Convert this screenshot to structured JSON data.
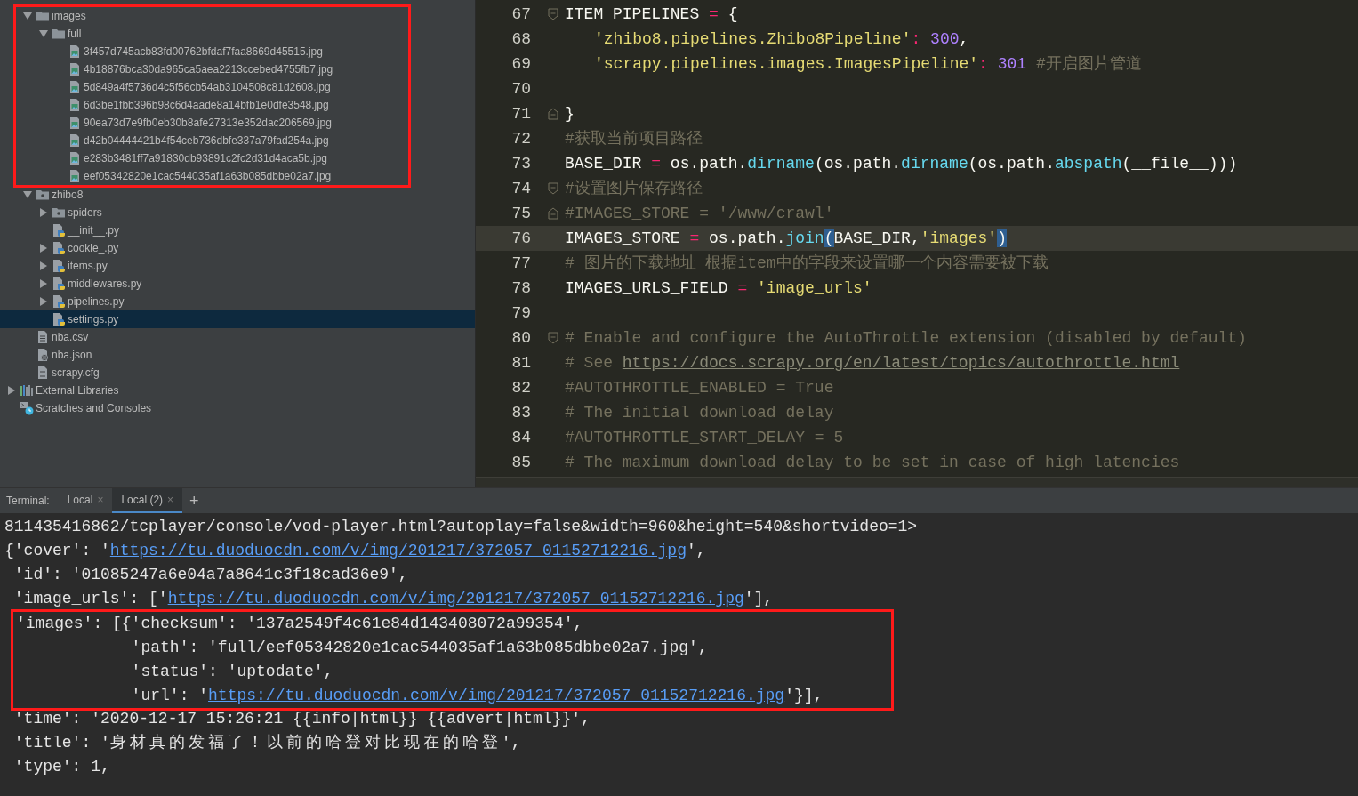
{
  "project_tree": {
    "project_items": [
      {
        "label": "images",
        "kind": "folder",
        "expanded": true,
        "highlighted": true,
        "selected": false,
        "children": [
          {
            "label": "full",
            "kind": "folder",
            "expanded": true,
            "selected": false,
            "children": [
              {
                "label": "3f457d745acb83fd00762bfdaf7faa8669d45515.jpg",
                "kind": "image",
                "selected": false
              },
              {
                "label": "4b18876bca30da965ca5aea2213ccebed4755fb7.jpg",
                "kind": "image",
                "selected": false
              },
              {
                "label": "5d849a4f5736d4c5f56cb54ab3104508c81d2608.jpg",
                "kind": "image",
                "selected": false
              },
              {
                "label": "6d3be1fbb396b98c6d4aade8a14bfb1e0dfe3548.jpg",
                "kind": "image",
                "selected": false
              },
              {
                "label": "90ea73d7e9fb0eb30b8afe27313e352dac206569.jpg",
                "kind": "image",
                "selected": false
              },
              {
                "label": "d42b04444421b4f54ceb736dbfe337a79fad254a.jpg",
                "kind": "image",
                "selected": false
              },
              {
                "label": "e283b3481ff7a91830db93891c2fc2d31d4aca5b.jpg",
                "kind": "image",
                "selected": false
              },
              {
                "label": "eef05342820e1cac544035af1a63b085dbbe02a7.jpg",
                "kind": "image",
                "selected": false
              }
            ]
          }
        ]
      },
      {
        "label": "zhibo8",
        "kind": "package",
        "expanded": true,
        "highlighted": false,
        "selected": false,
        "children": [
          {
            "label": "spiders",
            "kind": "package",
            "expanded": false,
            "selected": false
          },
          {
            "label": "__init__.py",
            "kind": "python",
            "selected": false
          },
          {
            "label": "cookie_.py",
            "kind": "python",
            "expanded": false,
            "selected": false
          },
          {
            "label": "items.py",
            "kind": "python",
            "expanded": false,
            "selected": false
          },
          {
            "label": "middlewares.py",
            "kind": "python",
            "expanded": false,
            "selected": false
          },
          {
            "label": "pipelines.py",
            "kind": "python",
            "expanded": false,
            "selected": false
          },
          {
            "label": "settings.py",
            "kind": "python",
            "selected": true
          }
        ]
      },
      {
        "label": "nba.csv",
        "kind": "text",
        "highlighted": false,
        "selected": false
      },
      {
        "label": "nba.json",
        "kind": "json",
        "highlighted": false,
        "selected": false
      },
      {
        "label": "scrapy.cfg",
        "kind": "text",
        "highlighted": false,
        "selected": false
      }
    ],
    "root_items": [
      {
        "label": "External Libraries",
        "kind": "library",
        "expanded": false,
        "selected": false
      },
      {
        "label": "Scratches and Consoles",
        "kind": "scratches",
        "selected": false
      }
    ]
  },
  "editor": {
    "lines": [
      {
        "no": "67",
        "fold": {
          "kind": "start"
        },
        "current": false,
        "indented": false,
        "tokens": [
          {
            "kind": "id",
            "text": "ITEM_PIPELINES "
          },
          {
            "kind": "op",
            "text": "="
          },
          {
            "kind": "id",
            "text": " {"
          }
        ]
      },
      {
        "no": "68",
        "current": false,
        "indented": true,
        "tokens": [
          {
            "kind": "str",
            "text": "'zhibo8.pipelines.Zhibo8Pipeline'"
          },
          {
            "kind": "op",
            "text": ":"
          },
          {
            "kind": "num",
            "text": " 300"
          },
          {
            "kind": "id",
            "text": ","
          }
        ]
      },
      {
        "no": "69",
        "current": false,
        "indented": true,
        "tokens": [
          {
            "kind": "str",
            "text": "'scrapy.pipelines.images.ImagesPipeline'"
          },
          {
            "kind": "op",
            "text": ":"
          },
          {
            "kind": "num",
            "text": " 301"
          },
          {
            "kind": "cmt",
            "text": " #开启图片管道"
          }
        ]
      },
      {
        "no": "70",
        "current": false
      },
      {
        "no": "71",
        "fold": {
          "kind": "end"
        },
        "current": false,
        "indented": false,
        "tokens": [
          {
            "kind": "id",
            "text": "}"
          }
        ]
      },
      {
        "no": "72",
        "current": false,
        "indented": false,
        "tokens": [
          {
            "kind": "cmt",
            "text": "#获取当前项目路径"
          }
        ]
      },
      {
        "no": "73",
        "current": false,
        "indented": false,
        "tokens": [
          {
            "kind": "id",
            "text": "BASE_DIR "
          },
          {
            "kind": "op",
            "text": "="
          },
          {
            "kind": "id",
            "text": " os.path."
          },
          {
            "kind": "fn",
            "text": "dirname"
          },
          {
            "kind": "id",
            "text": "(os.path."
          },
          {
            "kind": "fn",
            "text": "dirname"
          },
          {
            "kind": "id",
            "text": "(os.path."
          },
          {
            "kind": "fn",
            "text": "abspath"
          },
          {
            "kind": "id",
            "text": "(__file__)))"
          }
        ]
      },
      {
        "no": "74",
        "fold": {
          "kind": "start"
        },
        "current": false,
        "indented": false,
        "tokens": [
          {
            "kind": "cmt",
            "text": "#设置图片保存路径"
          }
        ]
      },
      {
        "no": "75",
        "fold": {
          "kind": "end"
        },
        "current": false,
        "indented": false,
        "tokens": [
          {
            "kind": "cmt",
            "text": "#IMAGES_STORE = '/www/crawl'"
          }
        ]
      },
      {
        "no": "76",
        "current": true,
        "indented": false,
        "tokens": [
          {
            "kind": "id",
            "text": "IMAGES_STORE "
          },
          {
            "kind": "op",
            "text": "="
          },
          {
            "kind": "id",
            "text": " os.path."
          },
          {
            "kind": "fn",
            "text": "join"
          },
          {
            "kind": "match",
            "text": "("
          },
          {
            "kind": "id",
            "text": "BASE_DIR,"
          },
          {
            "kind": "str",
            "text": "'images'"
          },
          {
            "kind": "match",
            "text": ")"
          }
        ]
      },
      {
        "no": "77",
        "current": false,
        "indented": false,
        "tokens": [
          {
            "kind": "cmt",
            "text": "# 图片的下载地址 根据item中的字段来设置哪一个内容需要被下载"
          }
        ]
      },
      {
        "no": "78",
        "current": false,
        "indented": false,
        "tokens": [
          {
            "kind": "id",
            "text": "IMAGES_URLS_FIELD "
          },
          {
            "kind": "op",
            "text": "="
          },
          {
            "kind": "str",
            "text": " 'image_urls'"
          }
        ]
      },
      {
        "no": "79",
        "current": false
      },
      {
        "no": "80",
        "fold": {
          "kind": "start"
        },
        "current": false,
        "indented": false,
        "tokens": [
          {
            "kind": "cmt",
            "text": "# Enable and configure the AutoThrottle extension (disabled by default)"
          }
        ]
      },
      {
        "no": "81",
        "current": false,
        "indented": false,
        "tokens": [
          {
            "kind": "cmt",
            "text": "# See "
          },
          {
            "kind": "link",
            "text": "https://docs.scrapy.org/en/latest/topics/autothrottle.html"
          }
        ]
      },
      {
        "no": "82",
        "current": false,
        "indented": false,
        "tokens": [
          {
            "kind": "cmt",
            "text": "#AUTOTHROTTLE_ENABLED = True"
          }
        ]
      },
      {
        "no": "83",
        "current": false,
        "indented": false,
        "tokens": [
          {
            "kind": "cmt",
            "text": "# The initial download delay"
          }
        ]
      },
      {
        "no": "84",
        "current": false,
        "indented": false,
        "tokens": [
          {
            "kind": "cmt",
            "text": "#AUTOTHROTTLE_START_DELAY = 5"
          }
        ]
      },
      {
        "no": "85",
        "current": false,
        "indented": false,
        "tokens": [
          {
            "kind": "cmt",
            "text": "# The maximum download delay to be set in case of high latencies"
          }
        ]
      }
    ]
  },
  "terminal": {
    "label": "Terminal:",
    "tabs": [
      {
        "label": "Local",
        "close": "×",
        "selected": false
      },
      {
        "label": "Local (2)",
        "close": "×",
        "selected": true
      }
    ],
    "new_tab": "+",
    "blocks": [
      {
        "highlighted": false,
        "lines": [
          [
            {
              "kind": "text",
              "text": "811435416862/tcplayer/console/vod-player.html?autoplay=false&width=960&height=540&shortvideo=1>"
            }
          ],
          [
            {
              "kind": "text",
              "text": "{'cover': '"
            },
            {
              "kind": "link",
              "text": "https://tu.duoduocdn.com/v/img/201217/372057_01152712216.jpg"
            },
            {
              "kind": "text",
              "text": "',"
            }
          ],
          [
            {
              "kind": "text",
              "text": " 'id': '01085247a6e04a7a8641c3f18cad36e9',"
            }
          ],
          [
            {
              "kind": "text",
              "text": " 'image_urls': ['"
            },
            {
              "kind": "link",
              "text": "https://tu.duoduocdn.com/v/img/201217/372057_01152712216.jpg"
            },
            {
              "kind": "text",
              "text": "'],"
            }
          ]
        ]
      },
      {
        "highlighted": true,
        "lines": [
          [
            {
              "kind": "text",
              "text": "'images': [{'checksum': '137a2549f4c61e84d143408072a99354',"
            }
          ],
          [
            {
              "kind": "text",
              "text": "            'path': 'full/eef05342820e1cac544035af1a63b085dbbe02a7.jpg',"
            }
          ],
          [
            {
              "kind": "text",
              "text": "            'status': 'uptodate',"
            }
          ],
          [
            {
              "kind": "text",
              "text": "            'url': '"
            },
            {
              "kind": "link",
              "text": "https://tu.duoduocdn.com/v/img/201217/372057_01152712216.jpg"
            },
            {
              "kind": "text",
              "text": "'}],"
            }
          ]
        ]
      },
      {
        "highlighted": false,
        "lines": [
          [
            {
              "kind": "text",
              "text": " 'time': '2020-12-17 15:26:21 {{info|html}} {{advert|html}}',"
            }
          ],
          [
            {
              "kind": "text",
              "text": " 'title': '"
            },
            {
              "kind": "wide",
              "text": "身材真的发福了！以前的哈登对比现在的哈登"
            },
            {
              "kind": "text",
              "text": "',"
            }
          ],
          [
            {
              "kind": "text",
              "text": " 'type': 1,"
            }
          ]
        ]
      }
    ]
  }
}
